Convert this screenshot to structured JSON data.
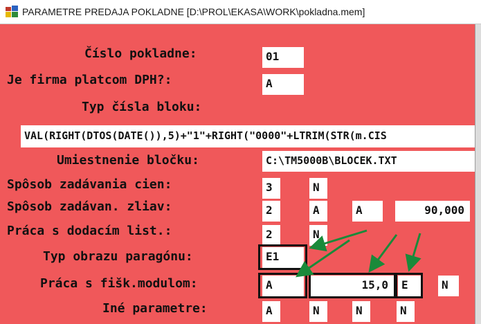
{
  "window": {
    "title": "PARAMETRE PREDAJA POKLADNE  [D:\\PROL\\EKASA\\WORK\\pokladna.mem]"
  },
  "form": {
    "cislo_pokladne": {
      "label": "Číslo pokladne:",
      "value": "01"
    },
    "platca_dph": {
      "label": "Je firma platcom DPH?:",
      "value": "A"
    },
    "typ_cisla_bloku": {
      "label": "Typ čísla bloku:",
      "value": "VAL(RIGHT(DTOS(DATE()),5)+\"1\"+RIGHT(\"0000\"+LTRIM(STR(m.CIS"
    },
    "umiestnenie_blocku": {
      "label": "Umiestnenie bločku:",
      "value": "C:\\TM5000B\\BLOCEK.TXT"
    },
    "sposob_cien": {
      "label": "Spôsob zadávania cien:",
      "values": [
        "3",
        "N"
      ]
    },
    "sposob_zliav": {
      "label": "Spôsob zadávan. zliav:",
      "values": [
        "2",
        "A",
        "A",
        "90,000"
      ]
    },
    "dodaci_list": {
      "label": "Práca s dodacím list.:",
      "values": [
        "2",
        "N"
      ]
    },
    "typ_obrazu": {
      "label": "Typ obrazu paragónu:",
      "value": "E1"
    },
    "fisk_modul": {
      "label": "Práca s fišk.modulom:",
      "values": [
        "A",
        "15,0",
        "E",
        "N"
      ]
    },
    "ine_parametre": {
      "label": "Iné parametre:",
      "values": [
        "A",
        "N",
        "N",
        "N"
      ]
    }
  },
  "colors": {
    "background": "#f0585a",
    "field": "#ffffff",
    "arrow": "#1a8a3a",
    "highlight": "#111111"
  },
  "icons": [
    "app-icon"
  ]
}
